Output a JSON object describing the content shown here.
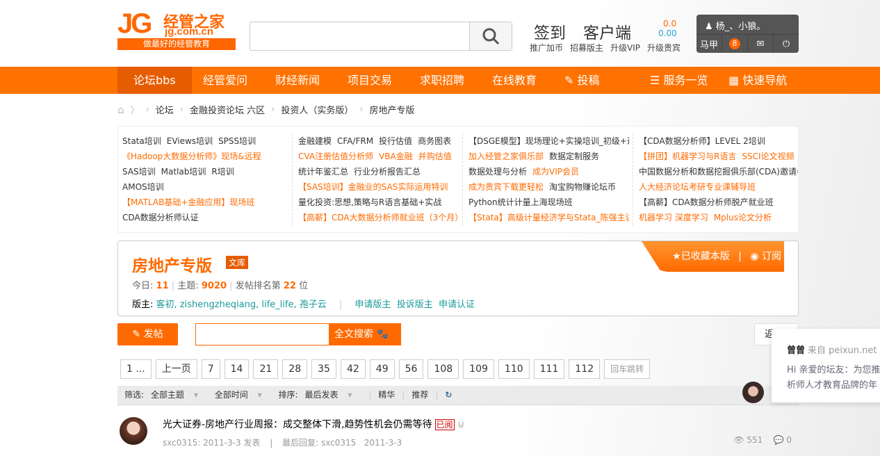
{
  "logo": {
    "text": "JG经管之家",
    "url": "jg.com.cn",
    "slogan": "做最好的经管教育"
  },
  "header": {
    "sign": "签到",
    "client": "客户端",
    "val1": "0.0",
    "val2": "0.00",
    "links": [
      "推广加币",
      "招募版主",
      "升级VIP",
      "升级贵宾"
    ]
  },
  "user": {
    "name": "杨_、小狼。",
    "alt": "马甲",
    "notif": "8"
  },
  "nav": [
    "论坛bbs",
    "经管爱问",
    "财经新闻",
    "项目交易",
    "求职招聘",
    "在线教育",
    "投稿",
    "服务一览",
    "快速导航"
  ],
  "breadcrumb": [
    "论坛",
    "金融投资论坛 六区",
    "投资人（实务版）",
    "房地产专版"
  ],
  "links": [
    [
      [
        {
          "t": "Stata培训"
        },
        {
          "t": "EViews培训"
        },
        {
          "t": "SPSS培训"
        }
      ],
      [
        {
          "t": "《Hadoop大数据分析师》现场&远程",
          "o": 1
        }
      ],
      [
        {
          "t": "SAS培训"
        },
        {
          "t": "Matlab培训"
        },
        {
          "t": "R培训"
        }
      ],
      [
        {
          "t": "AMOS培训"
        }
      ],
      [
        {
          "t": "【MATLAB基础+金融应用】现场班",
          "o": 1
        }
      ],
      [
        {
          "t": "CDA数据分析师认证"
        }
      ]
    ],
    [
      [
        {
          "t": "金融建模"
        },
        {
          "t": "CFA/FRM"
        },
        {
          "t": "投行估值"
        },
        {
          "t": "商务图表"
        }
      ],
      [
        {
          "t": "CVA注册估值分析师",
          "o": 1
        },
        {
          "t": "VBA金融",
          "o": 1
        },
        {
          "t": "并购估值",
          "o": 1
        }
      ],
      [
        {
          "t": "统计年鉴汇总"
        },
        {
          "t": "行业分析报告汇总"
        }
      ],
      [
        {
          "t": "【SAS培训】金融业的SAS实际运用特训",
          "o": 1
        }
      ],
      [
        {
          "t": "量化投资:思想,策略与R语言基础+实战"
        }
      ],
      [
        {
          "t": "【高薪】CDA大数据分析师就业班（3个月）",
          "o": 1
        }
      ]
    ],
    [
      [
        {
          "t": "【DSGE模型】现场理论+实操培训_初级+进"
        }
      ],
      [
        {
          "t": "加入经管之家俱乐部",
          "o": 1
        },
        {
          "t": "数据定制服务"
        }
      ],
      [
        {
          "t": "数据处理与分析"
        },
        {
          "t": "成为VIP会员",
          "o": 1
        }
      ],
      [
        {
          "t": "成为贵宾下载更轻松",
          "o": 1
        },
        {
          "t": "淘宝购物赚论坛币"
        }
      ],
      [
        {
          "t": "Python统计计量上海现场班"
        }
      ],
      [
        {
          "t": "【Stata】高级计量经济学与Stata_陈强主讲",
          "o": 1
        }
      ]
    ],
    [
      [
        {
          "t": "【CDA数据分析师】LEVEL 2培训"
        }
      ],
      [
        {
          "t": "【拼团】机器学习与R语言",
          "o": 1
        },
        {
          "t": "SSCI论文视频",
          "o": 1
        }
      ],
      [
        {
          "t": "中国数据分析和数据挖掘俱乐部(CDA)邀请参与"
        }
      ],
      [
        {
          "t": "人大经济论坛考研专业课辅导班",
          "o": 1
        }
      ],
      [
        {
          "t": "【高薪】CDA数据分析师脱产就业班"
        }
      ],
      [
        {
          "t": "机器学习 深度学习",
          "o": 1
        },
        {
          "t": "Mplus论文分析",
          "o": 1
        }
      ]
    ]
  ],
  "forum": {
    "title": "房地产专版",
    "tag": "文库",
    "today_label": "今日:",
    "today": "11",
    "topics_label": "主题:",
    "topics": "9020",
    "rank_label": "发帖排名第",
    "rank": "22",
    "rank_unit": "位",
    "mods_label": "版主:",
    "mods": "客初, zishengzheqiang, life_life, 孢子云",
    "apply": "申请版主",
    "complain": "投诉版主",
    "cert": "申请认证",
    "fav": "已收藏本版",
    "rss": "订阅"
  },
  "actions": {
    "post": "发帖",
    "fulltext": "全文搜索",
    "back": "返"
  },
  "pages": [
    "1 ...",
    "上一页",
    "7",
    "14",
    "21",
    "28",
    "35",
    "42",
    "49",
    "56",
    "108",
    "109",
    "110",
    "111",
    "112",
    "回车跳转"
  ],
  "filter": {
    "label": "筛选:",
    "all_topics": "全部主题",
    "all_time": "全部时间",
    "sort_label": "排序:",
    "sort": "最后发表",
    "digest": "精华",
    "recommend": "推荐"
  },
  "thread": {
    "title": "光大证券-房地产行业周报：成交整体下滑,趋势性机会仍需等待",
    "read": "已阅",
    "author": "sxc0315",
    "date": "2011-3-3 发表",
    "last_label": "最后回复:",
    "last_user": "sxc0315",
    "last_date": "2011-3-3",
    "views": "551",
    "replies": "0"
  },
  "popup": {
    "name": "曾曾",
    "from": "来自 peixun.net",
    "line1": "Hi 亲爱的坛友：为您推",
    "line2": "析师人才教育品牌的年"
  }
}
